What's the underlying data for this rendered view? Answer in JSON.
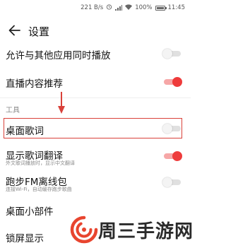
{
  "status_bar": {
    "network_speed": "221 B/s",
    "battery": "100%",
    "time": "11:45",
    "icons": [
      "alarm-icon",
      "signal-icon",
      "wifi-icon",
      "battery-icon"
    ]
  },
  "header": {
    "back_icon": "back-arrow-icon",
    "title": "设置"
  },
  "settings": [
    {
      "label": "允许与其他应用同时播放",
      "toggle": "off"
    },
    {
      "label": "直播内容推荐",
      "toggle": "on"
    }
  ],
  "tools_section": {
    "title": "工具",
    "items": [
      {
        "label": "桌面歌词",
        "toggle": "off",
        "highlighted": true
      },
      {
        "label": "显示歌词翻译",
        "subtitle": "外文歌词播放时，显示中文翻译",
        "toggle": "on"
      },
      {
        "label": "跑步FM离线包",
        "subtitle": "连接Wi-Fi，自动缓存跑步歌曲",
        "toggle": "off"
      },
      {
        "label": "桌面小部件"
      },
      {
        "label": "锁屏显示"
      }
    ]
  },
  "colors": {
    "accent_red": "#ee3b3b",
    "highlight_border": "#d9413a",
    "toggle_off": "#e0e0e0"
  },
  "watermark": {
    "text": "周三手游网",
    "logo_icon": "swirl-logo-icon"
  }
}
